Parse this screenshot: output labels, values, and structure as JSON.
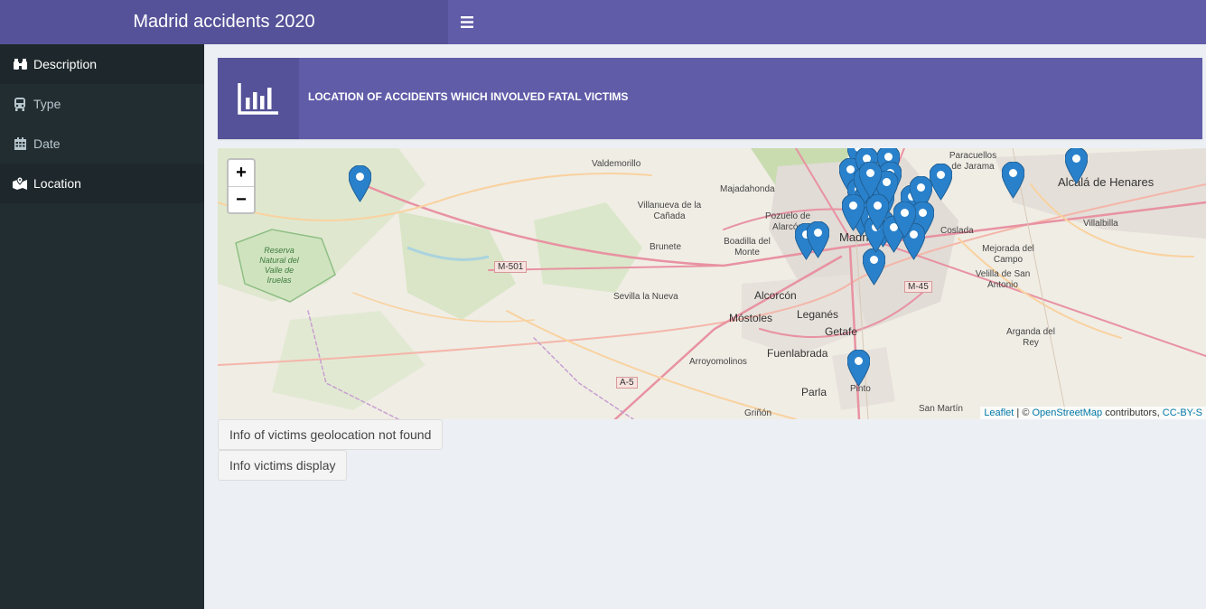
{
  "header": {
    "title": "Madrid accidents 2020",
    "toggle_icon": "bars-icon"
  },
  "sidebar": {
    "items": [
      {
        "label": "Description",
        "icon": "binoculars-icon"
      },
      {
        "label": "Type",
        "icon": "bus-icon"
      },
      {
        "label": "Date",
        "icon": "calendar-icon"
      },
      {
        "label": "Location",
        "icon": "map-marked-icon"
      }
    ]
  },
  "infobox": {
    "title": "LOCATION OF ACCIDENTS WHICH INVOLVED FATAL VICTIMS",
    "icon": "bar-chart-icon",
    "color": "#605ca8"
  },
  "map": {
    "zoom_in": "+",
    "zoom_out": "−",
    "attribution": {
      "leaflet": "Leaflet",
      "sep": " | © ",
      "osm": "OpenStreetMap",
      "contrib": " contributors, ",
      "license": "CC-BY-S"
    },
    "places": [
      "Valdemorillo",
      "Majadahonda",
      "Villanueva de la Cañada",
      "Pozuelo de Alarcón",
      "Boadilla del Monte",
      "Brunete",
      "Madrid",
      "Alcorcón",
      "Leganés",
      "Móstoles",
      "Getafe",
      "Fuenlabrada",
      "Parla",
      "Pinto",
      "Griñón",
      "Arroyomolinos",
      "Sevilla la Nueva",
      "Coslada",
      "Mejorada del Campo",
      "Velilla de San Antonio",
      "Arganda del Rey",
      "Villalbilla",
      "Alcalá de Henares",
      "Paracuellos de Jarama",
      "San Martín",
      "Reserva Natural del Valle de Iruelas"
    ],
    "roads": [
      "M-501",
      "M-45",
      "A-5"
    ],
    "marker_color": "#2a81cb"
  },
  "buttons": {
    "not_found": "Info of victims geolocation not found",
    "display": "Info victims display"
  }
}
